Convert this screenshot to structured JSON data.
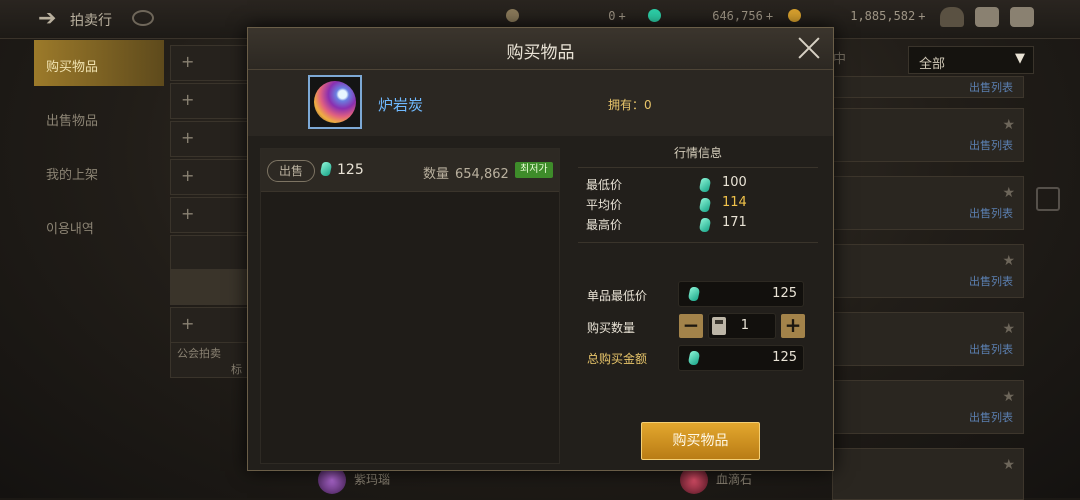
{
  "topbar": {
    "title": "拍卖行",
    "currency_1": "0",
    "currency_2": "646,756",
    "currency_3": "1,885,582"
  },
  "left_tabs": [
    "购买物品",
    "出售物品",
    "我的上架",
    "이용내역"
  ],
  "left_extra": {
    "a": "公会拍卖",
    "b": "标"
  },
  "right": {
    "filter_value": "全部",
    "list_link": "出售列表",
    "row_top_link": "出售列表",
    "bottom_items": [
      "紫玛瑙",
      "血滴石"
    ]
  },
  "modal": {
    "title": "购买物品",
    "item_name": "炉岩炭",
    "owned_label": "拥有：",
    "owned_value": "0",
    "listing": {
      "sell_label": "出售",
      "price": "125",
      "qty_label": "数量",
      "qty_value": "654,862",
      "tag": "최저가"
    },
    "market": {
      "title": "行情信息",
      "rows": [
        {
          "label": "最低价",
          "value": "100"
        },
        {
          "label": "平均价",
          "value": "114"
        },
        {
          "label": "最高价",
          "value": "171"
        }
      ]
    },
    "form": {
      "unit_label": "单品最低价",
      "unit_value": "125",
      "qty_label": "购买数量",
      "qty_value": "1",
      "total_label": "总购买金额",
      "total_value": "125"
    },
    "buy_button": "购买物品"
  },
  "colors": {
    "accent_gold": "#c88c1e",
    "gem": "#2dd0a8",
    "name_blue": "#6fb9ff",
    "tag_green": "#3e8c2a"
  }
}
